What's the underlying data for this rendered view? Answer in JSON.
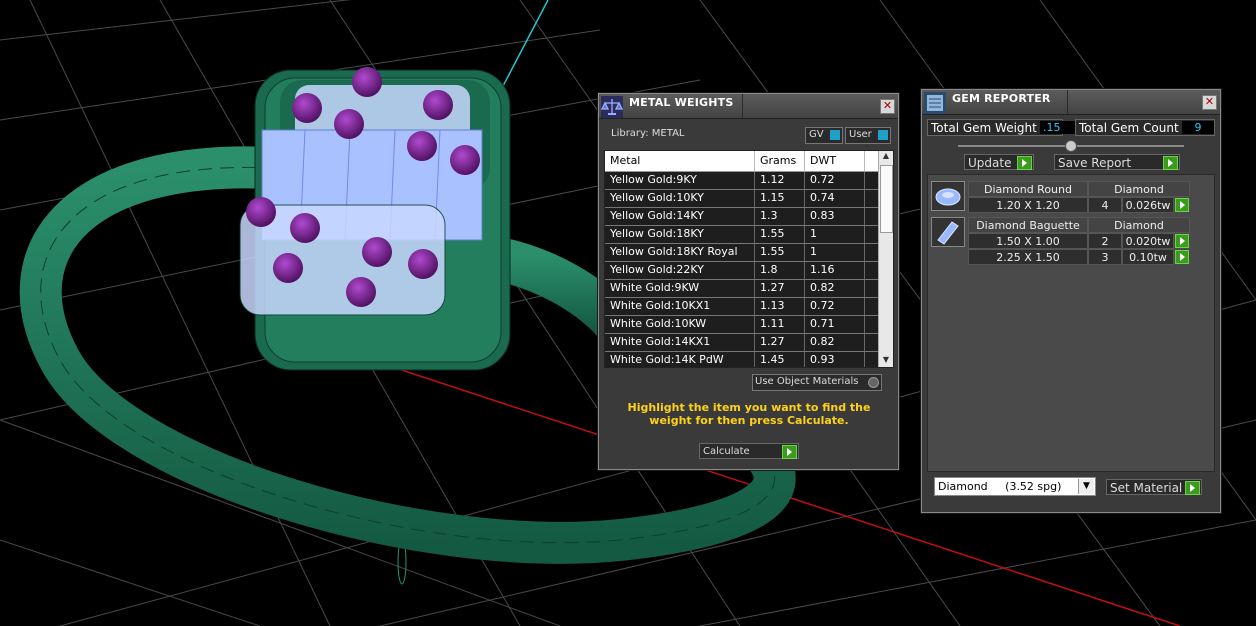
{
  "metal_weights": {
    "title": "METAL WEIGHTS",
    "library_label": "Library: METAL",
    "gv_label": "GV",
    "user_label": "User",
    "columns": [
      "Metal",
      "Grams",
      "DWT"
    ],
    "rows": [
      [
        "Yellow Gold:9KY",
        "1.12",
        "0.72"
      ],
      [
        "Yellow Gold:10KY",
        "1.15",
        "0.74"
      ],
      [
        "Yellow Gold:14KY",
        "1.3",
        "0.83"
      ],
      [
        "Yellow Gold:18KY",
        "1.55",
        "1"
      ],
      [
        "Yellow Gold:18KY Royal",
        "1.55",
        "1"
      ],
      [
        "Yellow Gold:22KY",
        "1.8",
        "1.16"
      ],
      [
        "White Gold:9KW",
        "1.27",
        "0.82"
      ],
      [
        "White Gold:10KX1",
        "1.13",
        "0.72"
      ],
      [
        "White Gold:10KW",
        "1.11",
        "0.71"
      ],
      [
        "White Gold:14KX1",
        "1.27",
        "0.82"
      ],
      [
        "White Gold:14K PdW",
        "1.45",
        "0.93"
      ]
    ],
    "use_object_materials": "Use Object Materials",
    "instruction": "Highlight the item you want to find the weight for then press Calculate.",
    "calculate_label": "Calculate"
  },
  "gem_reporter": {
    "title": "GEM REPORTER",
    "total_weight_label": "Total Gem Weight",
    "total_weight_value": ".15",
    "total_count_label": "Total Gem Count",
    "total_count_value": "9",
    "update_label": "Update",
    "save_report_label": "Save Report",
    "groups": [
      {
        "name": "Diamond Round",
        "material": "Diamond",
        "icon": "round-gem-icon",
        "rows": [
          [
            "1.20 X 1.20",
            "4",
            "0.026tw"
          ]
        ]
      },
      {
        "name": "Diamond Baguette",
        "material": "Diamond",
        "icon": "baguette-gem-icon",
        "rows": [
          [
            "1.50 X 1.00",
            "2",
            "0.020tw"
          ],
          [
            "2.25 X 1.50",
            "3",
            "0.10tw"
          ]
        ]
      }
    ],
    "material_select": "Diamond     (3.52 spg)",
    "set_material_label": "Set Material"
  },
  "colors": {
    "ring": "#1f7a5c",
    "gem_purple": "#7a1f8a",
    "stone_blue": "#a9c2ff",
    "accent_yellow": "#ffd21a"
  }
}
